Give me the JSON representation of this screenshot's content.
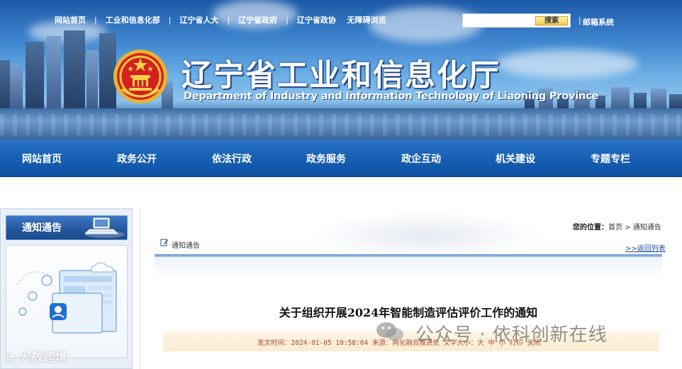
{
  "header": {
    "top_links": [
      "网站首页",
      "工业和信息化部",
      "辽宁省人大",
      "辽宁省政府",
      "辽宁省政协",
      "无障碍浏览"
    ],
    "search": {
      "placeholder": "",
      "button_label": "搜索"
    },
    "mail_link": "邮箱系统",
    "site_title": "辽宁省工业和信息化厅",
    "site_subtitle": "Department of Industry and Information Technology of Liaoning Province"
  },
  "main_nav": [
    "网站首页",
    "政务公开",
    "依法行政",
    "政务服务",
    "政企互动",
    "机关建设",
    "专题专栏"
  ],
  "sidebar": {
    "title": "通知通告"
  },
  "content": {
    "breadcrumb": {
      "label": "您的位置：",
      "path": "首页 > 通知通告"
    },
    "section_label": "通知通告",
    "back_link": ">>返回列表",
    "article_title": "关于组织开展2024年智能制造评估评价工作的通知",
    "meta": "发文时间：2024-01-05 10:58:04 来源：两化融合推进处 文字大小：大 中 小    打印    关闭"
  },
  "watermarks": {
    "main": "公众号 · 依科创新在线",
    "left": "大数跨境"
  },
  "colors": {
    "nav_blue": "#1860b3",
    "link_blue": "#1d4f9a",
    "meta_red": "#b24a2f"
  }
}
